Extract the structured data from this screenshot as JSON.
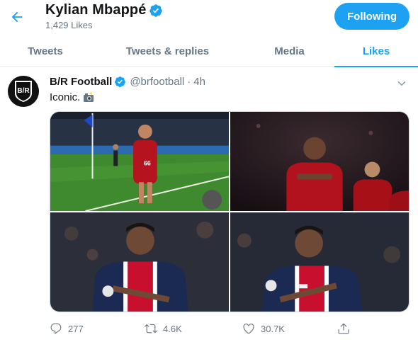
{
  "header": {
    "profile_name": "Kylian Mbappé",
    "likes_count": "1,429 Likes",
    "follow_label": "Following"
  },
  "tabs": [
    {
      "label": "Tweets",
      "active": false
    },
    {
      "label": "Tweets & replies",
      "active": false
    },
    {
      "label": "Media",
      "active": false
    },
    {
      "label": "Likes",
      "active": true
    }
  ],
  "tweet": {
    "author_name": "B/R Football",
    "author_handle": "@brfootball",
    "separator": "·",
    "time": "4h",
    "avatar_text": "B/R",
    "text": "Iconic.",
    "emoji": "camera-with-flash",
    "photos": [
      {
        "name": "photo-corner-flag-celebration",
        "kit_number": "66"
      },
      {
        "name": "photo-liverpool-players"
      },
      {
        "name": "photo-psg-player-left"
      },
      {
        "name": "photo-psg-player-right"
      }
    ],
    "actions": {
      "replies": "277",
      "retweets": "4.6K",
      "likes": "30.7K"
    }
  },
  "colors": {
    "accent": "#1da1f2",
    "text_primary": "#14171a",
    "text_secondary": "#657786",
    "border": "#e6ecf0"
  }
}
